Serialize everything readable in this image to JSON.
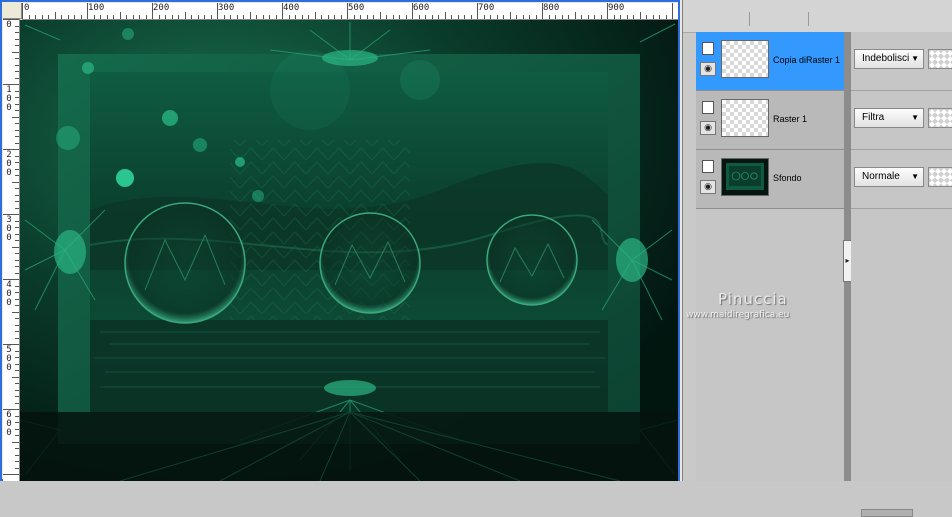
{
  "ruler": {
    "h_labels": [
      "0",
      "100",
      "200",
      "300",
      "400",
      "500",
      "600",
      "700",
      "800",
      "900"
    ],
    "v_labels": [
      "0",
      "1\n0\n0",
      "2\n0\n0",
      "3\n0\n0",
      "4\n0\n0",
      "5\n0\n0",
      "6\n0\n0"
    ]
  },
  "layers": [
    {
      "name": "Copia diRaster 1",
      "blend": "Indebolisci",
      "selected": true,
      "thumb": "transparent"
    },
    {
      "name": "Raster 1",
      "blend": "Filtra",
      "selected": false,
      "thumb": "transparent"
    },
    {
      "name": "Sfondo",
      "blend": "Normale",
      "selected": false,
      "thumb": "image"
    }
  ],
  "watermark": {
    "name": "Pinuccia",
    "url": "www.maidiregrafica.eu"
  },
  "colors": {
    "selection": "#3399ff",
    "canvas_green": "#0e5a40",
    "window_border": "#2e6de0"
  }
}
